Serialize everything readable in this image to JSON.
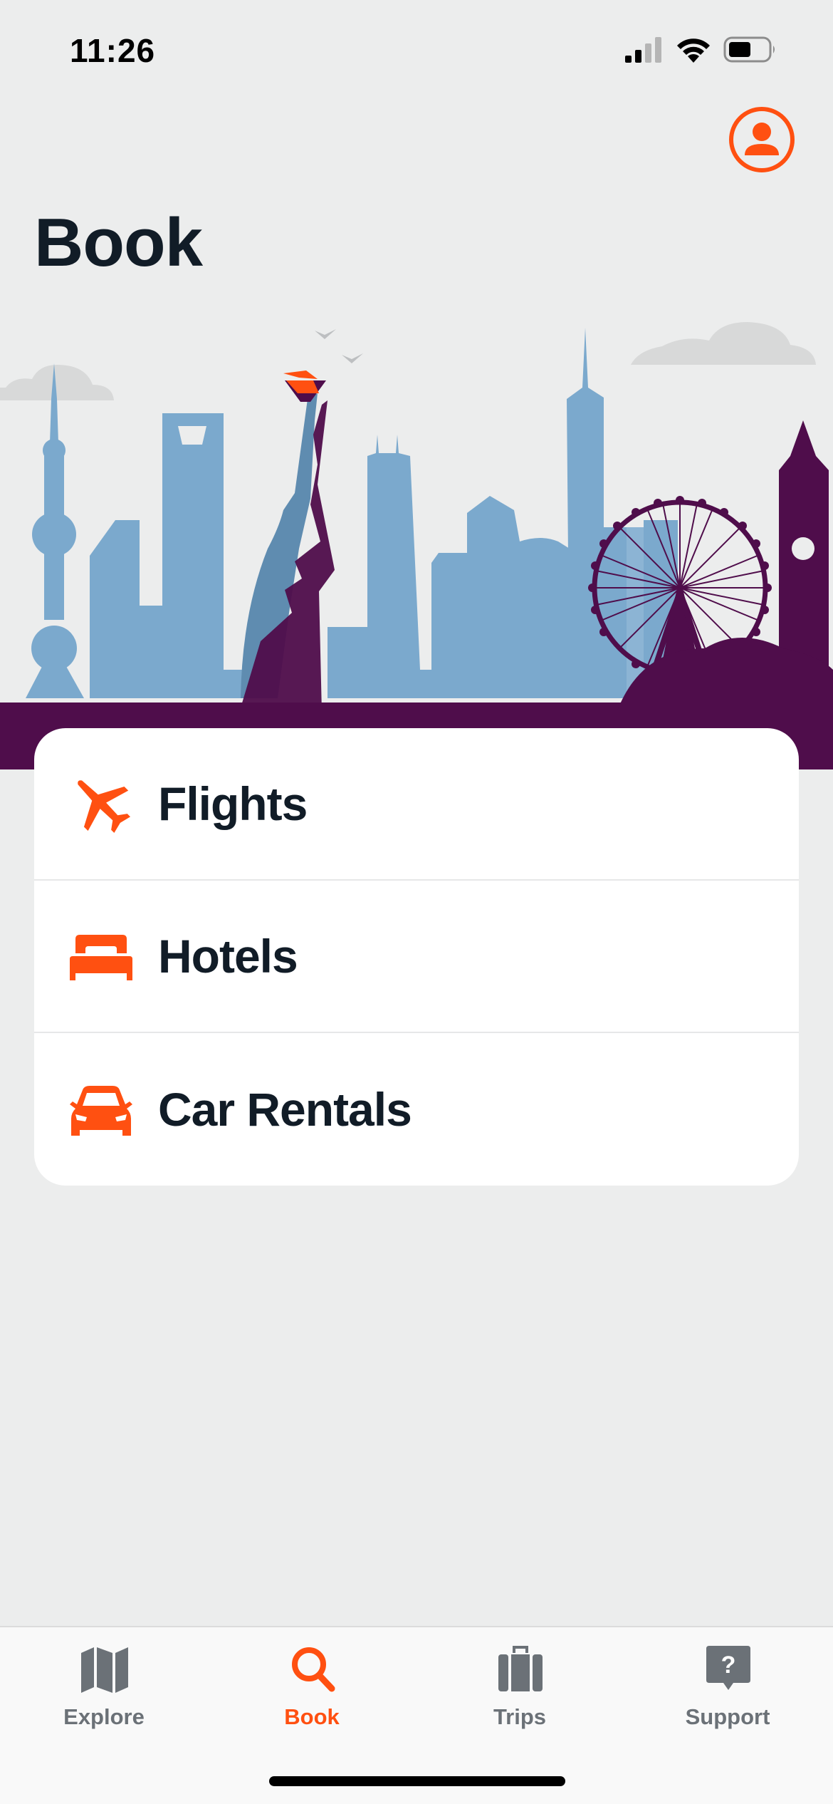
{
  "status_bar": {
    "time": "11:26"
  },
  "header": {
    "title": "Book"
  },
  "menu": {
    "items": [
      {
        "label": "Flights",
        "icon": "airplane-icon"
      },
      {
        "label": "Hotels",
        "icon": "bed-icon"
      },
      {
        "label": "Car Rentals",
        "icon": "car-icon"
      }
    ]
  },
  "tabs": [
    {
      "label": "Explore",
      "icon": "map-icon",
      "active": false
    },
    {
      "label": "Book",
      "icon": "search-icon",
      "active": true
    },
    {
      "label": "Trips",
      "icon": "suitcase-icon",
      "active": false
    },
    {
      "label": "Support",
      "icon": "help-chat-icon",
      "active": false
    }
  ],
  "colors": {
    "accent": "#FF5011",
    "background": "#ECEDED",
    "skyline_blue": "#7BA9CD",
    "skyline_purple": "#4F0D4B",
    "text": "#111C27",
    "tab_inactive": "#6B7177"
  }
}
